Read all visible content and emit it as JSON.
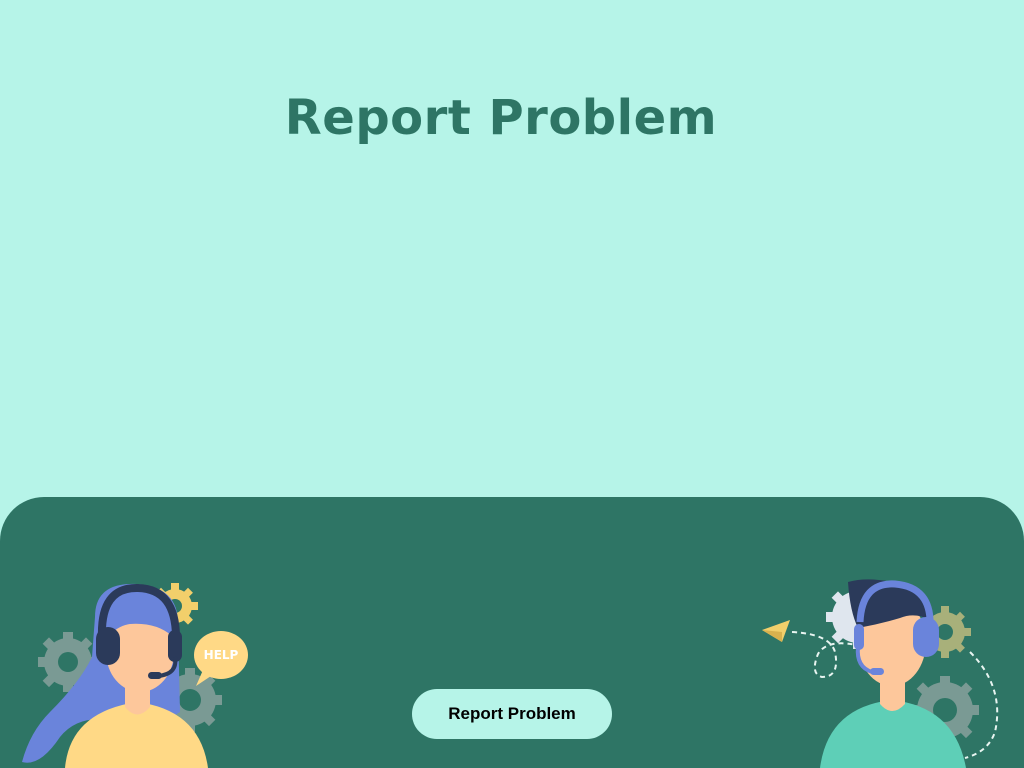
{
  "header": {
    "title": "Report Problem"
  },
  "footer": {
    "report_button_label": "Report Problem",
    "left_illustration": {
      "icon": "female-support-agent-icon",
      "speech_bubble_text": "HELP"
    },
    "right_illustration": {
      "icon": "male-support-agent-icon"
    }
  },
  "colors": {
    "background": "#b6f4e8",
    "panel": "#2e7565",
    "title": "#2e7565",
    "button_bg": "#b6f4e8",
    "button_text": "#000000",
    "hair_female": "#6a84db",
    "shirt_female": "#ffd986",
    "skin": "#fdc79b",
    "headset": "#2b3a5a",
    "shirt_male": "#5ecfb7",
    "gear_grey": "#7a9a94",
    "gear_yellow": "#f2cf6b",
    "gear_olive": "#a8b07a"
  }
}
